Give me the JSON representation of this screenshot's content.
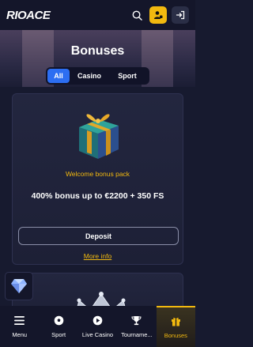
{
  "header": {
    "logo": "RIOACE",
    "icons": [
      "search-icon",
      "user-icon",
      "login-icon"
    ],
    "colors": {
      "accent": "#f2b90f"
    }
  },
  "hero": {
    "title": "Bonuses"
  },
  "tabs": [
    {
      "label": "All",
      "active": true
    },
    {
      "label": "Casino",
      "active": false
    },
    {
      "label": "Sport",
      "active": false
    }
  ],
  "bonus_card": {
    "image": "gift-box",
    "subtitle": "Welcome bonus pack",
    "title": "400% bonus up to €2200 + 350 FS",
    "deposit_label": "Deposit",
    "more_info_label": "More info"
  },
  "bottom_nav": [
    {
      "label": "Menu",
      "icon": "menu-icon"
    },
    {
      "label": "Sport",
      "icon": "sport-ball-icon"
    },
    {
      "label": "Live Casino",
      "icon": "play-icon"
    },
    {
      "label": "Tourname...",
      "icon": "trophy-icon"
    },
    {
      "label": "Bonuses",
      "icon": "gift-icon",
      "active": true
    }
  ]
}
